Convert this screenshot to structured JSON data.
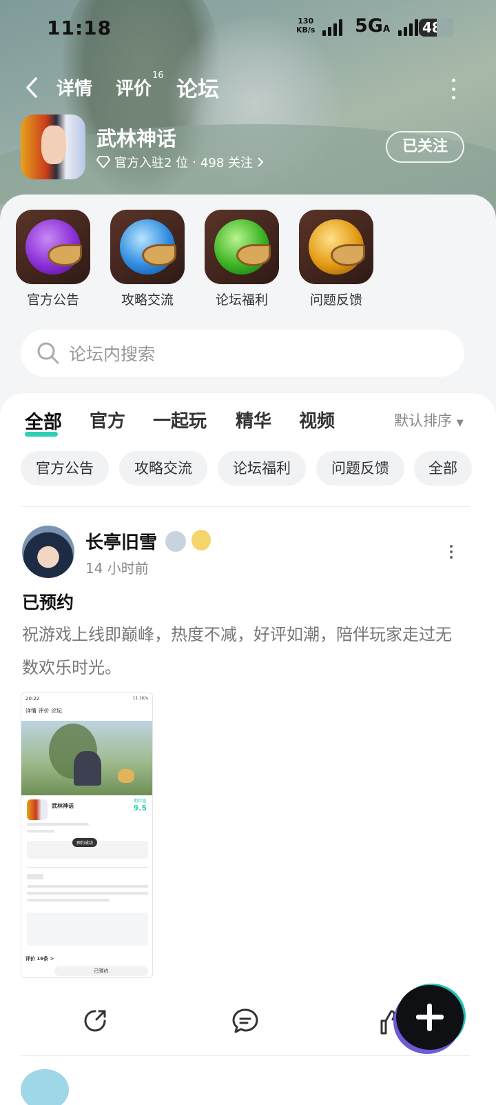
{
  "status_bar": {
    "time": "11:18",
    "speed_value": "130",
    "speed_unit": "KB/s",
    "network": "5G",
    "network_sub": "A",
    "battery": "48"
  },
  "nav": {
    "tabs": [
      {
        "label": "详情"
      },
      {
        "label": "评价"
      },
      {
        "label": "论坛"
      }
    ],
    "review_count": "16",
    "active_tab": "论坛"
  },
  "game": {
    "name": "武林神话",
    "stat_prefix": "官方入驻2 位",
    "separator": "·",
    "followers": "498 关注",
    "follow_button": "已关注"
  },
  "quick_links": [
    {
      "label": "官方公告",
      "orb_color": "#8a2fd6"
    },
    {
      "label": "攻略交流",
      "orb_color": "#2f8be0"
    },
    {
      "label": "论坛福利",
      "orb_color": "#3cb324"
    },
    {
      "label": "问题反馈",
      "orb_color": "#e39a12"
    }
  ],
  "search": {
    "placeholder": "论坛内搜索"
  },
  "feed_tabs": {
    "items": [
      "全部",
      "官方",
      "一起玩",
      "精华",
      "视频"
    ],
    "active": "全部",
    "sort_label": "默认排序"
  },
  "chips": [
    "官方公告",
    "攻略交流",
    "论坛福利",
    "问题反馈",
    "全部"
  ],
  "post": {
    "username": "长亭旧雪",
    "time": "14 小时前",
    "title": "已预约",
    "body": "祝游戏上线即巅峰，热度不减，好评如潮，陪伴玩家走过无数欢乐时光。",
    "screenshot": {
      "time": "20:22",
      "status": "11.1K/s",
      "tabs": "详情  评价  论坛",
      "game_name": "武林神话",
      "score": "9.5",
      "score_label": "期待值",
      "toast": "预约成功",
      "footer": "评价 16条 >",
      "button": "已预约"
    }
  },
  "colors": {
    "accent": "#2ecfb4",
    "fab": "#0f1014"
  }
}
